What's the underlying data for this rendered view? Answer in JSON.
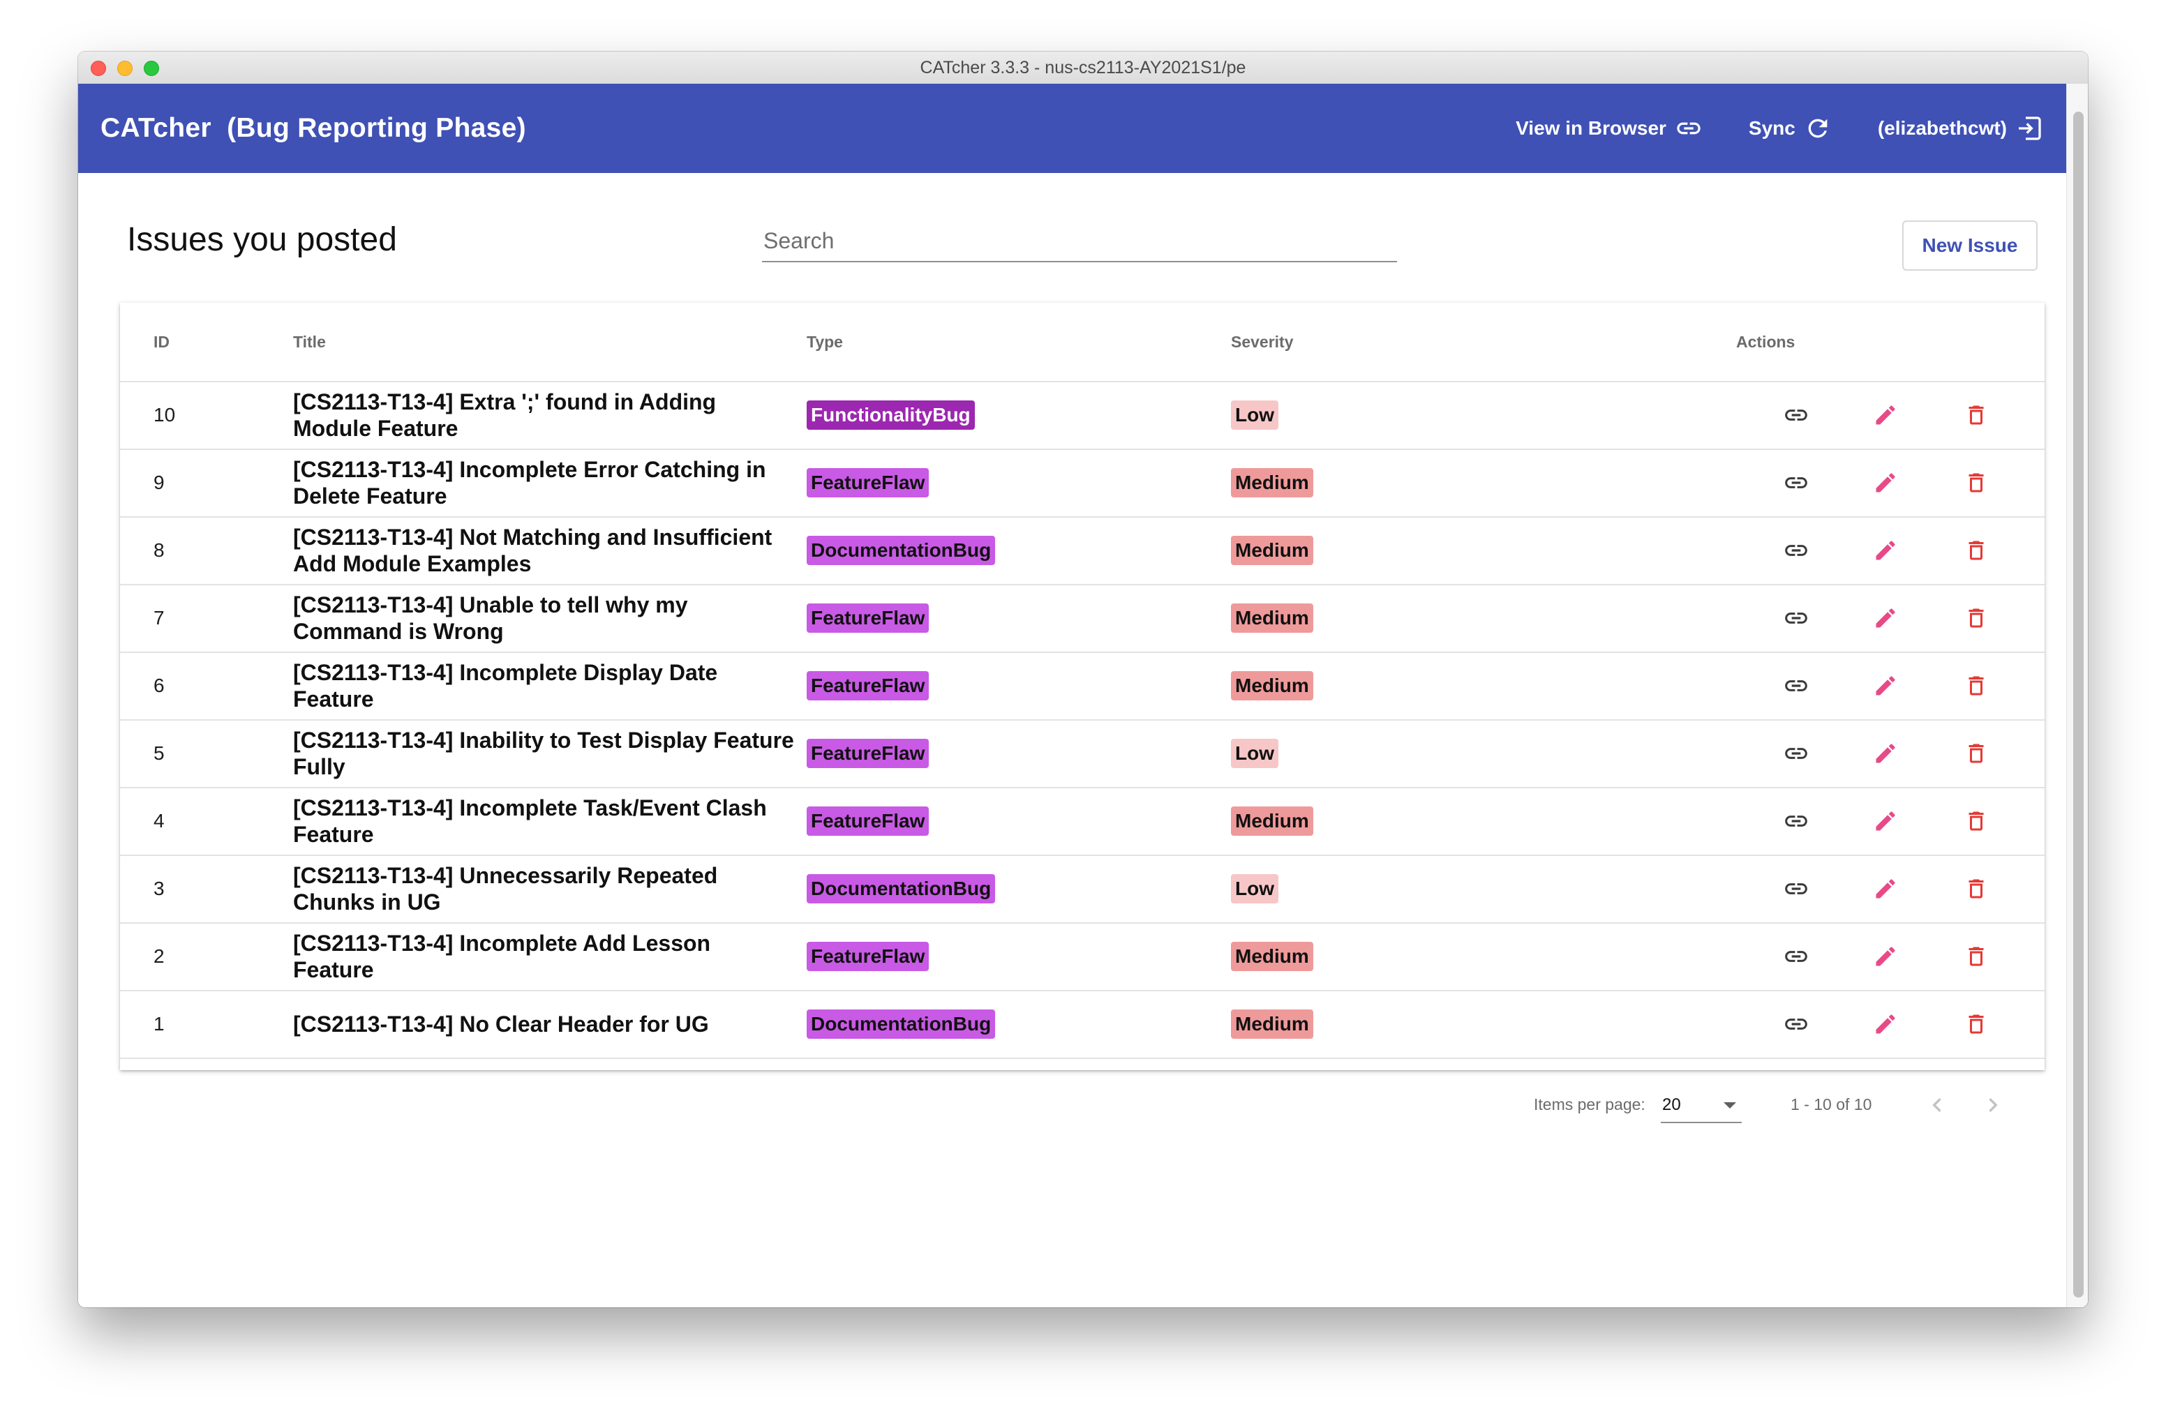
{
  "window": {
    "title": "CATcher 3.3.3 - nus-cs2113-AY2021S1/pe"
  },
  "appbar": {
    "title": "CATcher  (Bug Reporting Phase)",
    "view_in_browser": "View in Browser",
    "sync": "Sync",
    "user": "(elizabethcwt)"
  },
  "page": {
    "heading": "Issues you posted",
    "search_placeholder": "Search",
    "new_issue": "New Issue"
  },
  "table": {
    "headers": {
      "id": "ID",
      "title": "Title",
      "type": "Type",
      "severity": "Severity",
      "actions": "Actions"
    },
    "rows": [
      {
        "id": "10",
        "title": "[CS2113-T13-4] Extra ';' found in Adding Module Feature",
        "type": "FunctionalityBug",
        "severity": "Low"
      },
      {
        "id": "9",
        "title": "[CS2113-T13-4] Incomplete Error Catching in Delete Feature",
        "type": "FeatureFlaw",
        "severity": "Medium"
      },
      {
        "id": "8",
        "title": "[CS2113-T13-4] Not Matching and Insufficient Add Module Examples",
        "type": "DocumentationBug",
        "severity": "Medium"
      },
      {
        "id": "7",
        "title": "[CS2113-T13-4] Unable to tell why my Command is Wrong",
        "type": "FeatureFlaw",
        "severity": "Medium"
      },
      {
        "id": "6",
        "title": "[CS2113-T13-4] Incomplete Display Date Feature",
        "type": "FeatureFlaw",
        "severity": "Medium"
      },
      {
        "id": "5",
        "title": "[CS2113-T13-4] Inability to Test Display Feature Fully",
        "type": "FeatureFlaw",
        "severity": "Low"
      },
      {
        "id": "4",
        "title": "[CS2113-T13-4] Incomplete Task/Event Clash Feature",
        "type": "FeatureFlaw",
        "severity": "Medium"
      },
      {
        "id": "3",
        "title": "[CS2113-T13-4] Unnecessarily Repeated Chunks in UG",
        "type": "DocumentationBug",
        "severity": "Low"
      },
      {
        "id": "2",
        "title": "[CS2113-T13-4] Incomplete Add Lesson Feature",
        "type": "FeatureFlaw",
        "severity": "Medium"
      },
      {
        "id": "1",
        "title": "[CS2113-T13-4] No Clear Header for UG",
        "type": "DocumentationBug",
        "severity": "Medium"
      }
    ]
  },
  "paginator": {
    "items_per_page_label": "Items per page:",
    "items_per_page": "20",
    "range": "1 - 10 of 10"
  },
  "colors": {
    "appbar": "#3f51b5",
    "functionality_bug": "#9c27b0",
    "feature_flaw": "#c95ae5",
    "documentation_bug": "#c95ae5",
    "severity_low": "#f7c7c7",
    "severity_medium": "#ef9a9a",
    "edit_icon": "#e84a87",
    "delete_icon": "#e53935"
  }
}
